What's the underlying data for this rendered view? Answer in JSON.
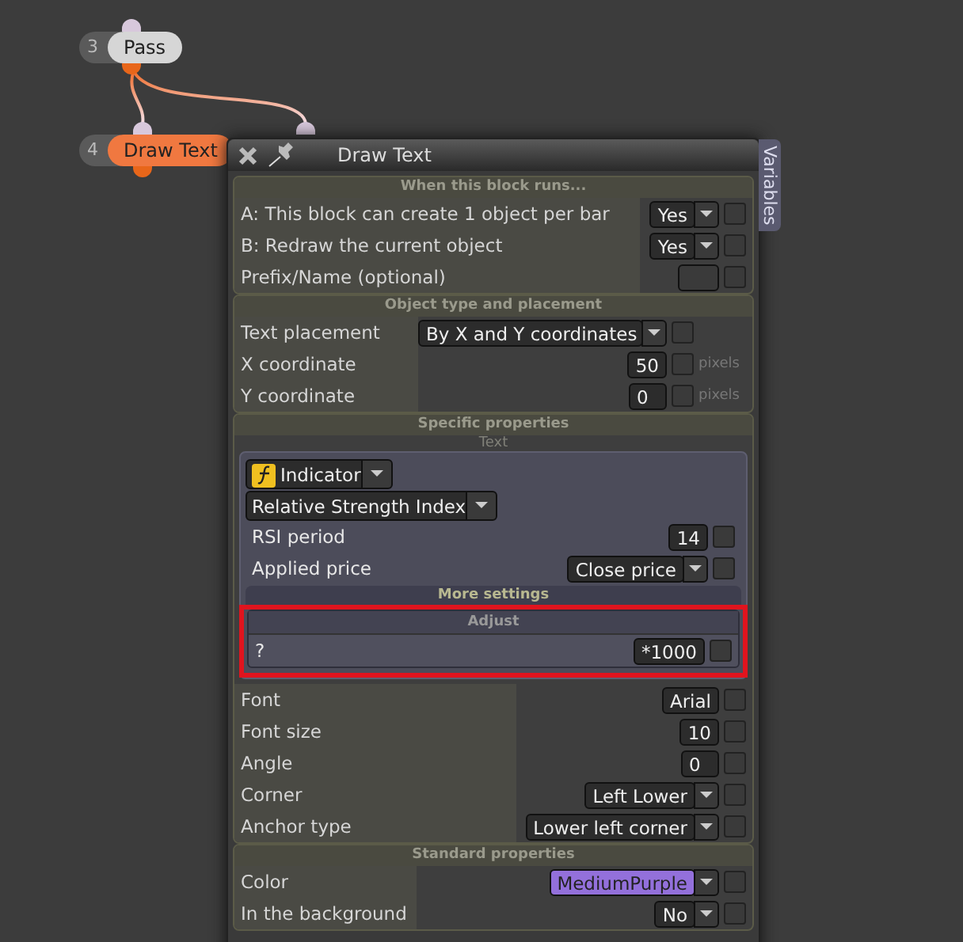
{
  "canvas": {
    "nodes": [
      {
        "number": "3",
        "label": "Pass",
        "selected": false
      },
      {
        "number": "4",
        "label": "Draw Text",
        "selected": true
      }
    ]
  },
  "window": {
    "title": "Draw Text",
    "side_tab": "Variables"
  },
  "sections": [
    {
      "title": "When this block runs...",
      "rows": [
        {
          "kind": "dropdown",
          "label": "A: This block can create 1 object per bar",
          "value": "Yes",
          "checked": false
        },
        {
          "kind": "dropdown",
          "label": "B: Redraw the current object",
          "value": "Yes",
          "checked": false
        },
        {
          "kind": "text",
          "label": "Prefix/Name (optional)",
          "checked": false
        }
      ]
    },
    {
      "title": "Object type and placement",
      "rows": [
        {
          "kind": "dropdown",
          "label": "Text placement",
          "value": "By X and Y coordinates",
          "checked": false
        },
        {
          "kind": "number",
          "label": "X coordinate",
          "value": "50",
          "unit": "pixels",
          "checked": false
        },
        {
          "kind": "number",
          "label": "Y coordinate",
          "value": "0",
          "unit": "pixels",
          "checked": false
        }
      ]
    },
    {
      "title": "Specific properties",
      "subtitle": "Text",
      "panel": {
        "selectors": [
          {
            "value": "Indicator",
            "icon": true
          },
          {
            "value": "Relative Strength Index",
            "icon": false
          }
        ],
        "rows": [
          {
            "kind": "number",
            "label": "RSI period",
            "value": "14",
            "checked": false
          },
          {
            "kind": "dropdown",
            "label": "Applied price",
            "value": "Close price",
            "checked": false
          }
        ],
        "more_title": "More settings",
        "adjust": {
          "title": "Adjust",
          "highlighted": true,
          "rows": [
            {
              "kind": "number",
              "label": "?",
              "value": "*1000",
              "checked": false
            }
          ]
        }
      },
      "rows": [
        {
          "kind": "number",
          "label": "Font",
          "value": "Arial",
          "checked": false
        },
        {
          "kind": "number",
          "label": "Font size",
          "value": "10",
          "checked": false
        },
        {
          "kind": "number",
          "label": "Angle",
          "value": "0",
          "checked": false
        },
        {
          "kind": "dropdown",
          "label": "Corner",
          "value": "Left Lower",
          "checked": false
        },
        {
          "kind": "dropdown",
          "label": "Anchor type",
          "value": "Lower left corner",
          "checked": false
        }
      ]
    },
    {
      "title": "Standard properties",
      "rows": [
        {
          "kind": "color",
          "label": "Color",
          "value": "MediumPurple",
          "color": "#9370db",
          "checked": false
        },
        {
          "kind": "dropdown",
          "label": "In the background",
          "value": "No",
          "checked": false
        }
      ]
    }
  ]
}
